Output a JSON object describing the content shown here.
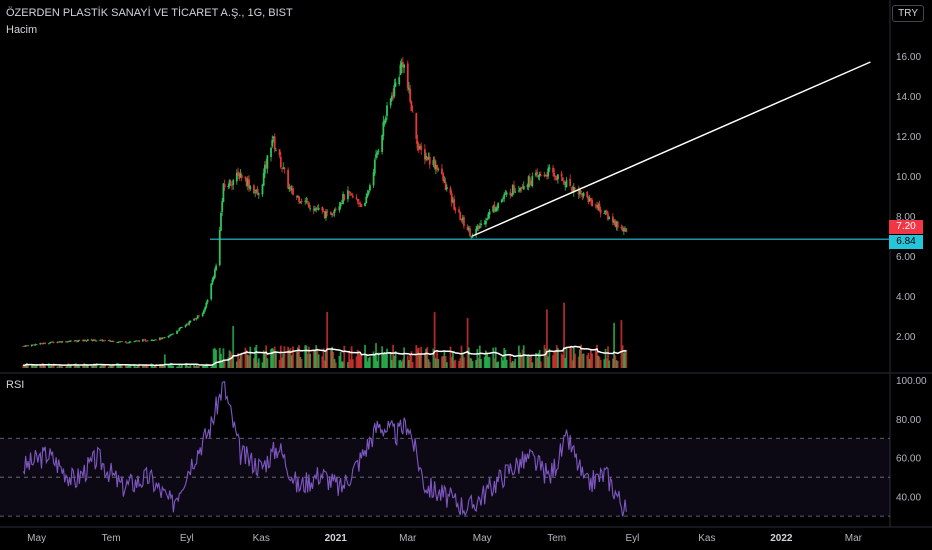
{
  "header": {
    "title": "ÖZERDEN PLASTİK SANAYİ VE TİCARET A.Ş., 1G, BIST",
    "volume_label": "Hacim"
  },
  "currency_badge": "TRY",
  "price_tags": {
    "last": "7.20",
    "support": "6.84"
  },
  "rsi_label": "RSI",
  "colors": {
    "up": "#2fc55a",
    "down": "#e53935",
    "trend": "#ffffff",
    "support": "#26c6da",
    "rsi": "#7e57c2",
    "ma": "#ffffff"
  },
  "chart_data": [
    {
      "type": "line",
      "name_hint": "price-candles",
      "yaxis_ticks": [
        "16.00",
        "14.00",
        "12.00",
        "10.00",
        "8.00",
        "6.00",
        "4.00",
        "2.00"
      ],
      "ylim": [
        0.6,
        16.9
      ],
      "x_ticks": [
        "May",
        "Tem",
        "Eyl",
        "Kas",
        "2021",
        "Mar",
        "May",
        "Tem",
        "Eyl",
        "Kas",
        "2022",
        "Mar"
      ],
      "x": [
        "2020-04-20",
        "2020-05-15",
        "2020-06-15",
        "2020-07-15",
        "2020-08-15",
        "2020-09-01",
        "2020-09-15",
        "2020-09-25",
        "2020-10-01",
        "2020-10-15",
        "2020-10-30",
        "2020-11-10",
        "2020-11-25",
        "2020-12-10",
        "2020-12-25",
        "2021-01-10",
        "2021-01-25",
        "2021-02-10",
        "2021-02-25",
        "2021-03-10",
        "2021-03-25",
        "2021-04-10",
        "2021-04-23",
        "2021-05-10",
        "2021-05-25",
        "2021-06-10",
        "2021-06-25",
        "2021-07-10",
        "2021-07-20",
        "2021-08-01",
        "2021-08-15",
        "2021-08-27"
      ],
      "y": [
        1.5,
        1.7,
        1.8,
        1.7,
        1.9,
        2.6,
        3.2,
        5.5,
        9.4,
        10.1,
        9.0,
        11.9,
        9.2,
        8.6,
        8.0,
        9.1,
        8.5,
        12.8,
        15.8,
        11.3,
        10.5,
        8.2,
        7.0,
        8.4,
        9.3,
        9.8,
        10.2,
        9.6,
        9.2,
        8.6,
        7.8,
        7.2
      ],
      "support_line": 6.84,
      "trendline": {
        "from": [
          "2021-04-23",
          7.0
        ],
        "to": [
          "2022-03-15",
          15.7
        ]
      }
    },
    {
      "type": "bar",
      "name_hint": "volume",
      "label": "Hacim"
    },
    {
      "type": "line",
      "name_hint": "rsi",
      "label": "RSI",
      "yaxis_ticks": [
        "100.00",
        "80.00",
        "60.00",
        "40.00"
      ],
      "ylim": [
        28,
        102
      ],
      "band": [
        30,
        70
      ],
      "x": [
        "2020-04-20",
        "2020-05-10",
        "2020-06-01",
        "2020-06-20",
        "2020-07-10",
        "2020-08-01",
        "2020-08-20",
        "2020-09-05",
        "2020-09-20",
        "2020-10-01",
        "2020-10-15",
        "2020-11-01",
        "2020-11-15",
        "2020-12-01",
        "2020-12-20",
        "2021-01-05",
        "2021-01-20",
        "2021-02-05",
        "2021-02-20",
        "2021-03-01",
        "2021-03-15",
        "2021-04-01",
        "2021-04-20",
        "2021-05-10",
        "2021-05-25",
        "2021-06-10",
        "2021-06-25",
        "2021-07-10",
        "2021-07-25",
        "2021-08-10",
        "2021-08-27"
      ],
      "y": [
        55,
        62,
        48,
        60,
        45,
        50,
        36,
        58,
        75,
        98,
        62,
        55,
        66,
        45,
        52,
        44,
        58,
        77,
        72,
        78,
        46,
        40,
        34,
        46,
        55,
        60,
        50,
        70,
        46,
        52,
        32
      ]
    }
  ]
}
